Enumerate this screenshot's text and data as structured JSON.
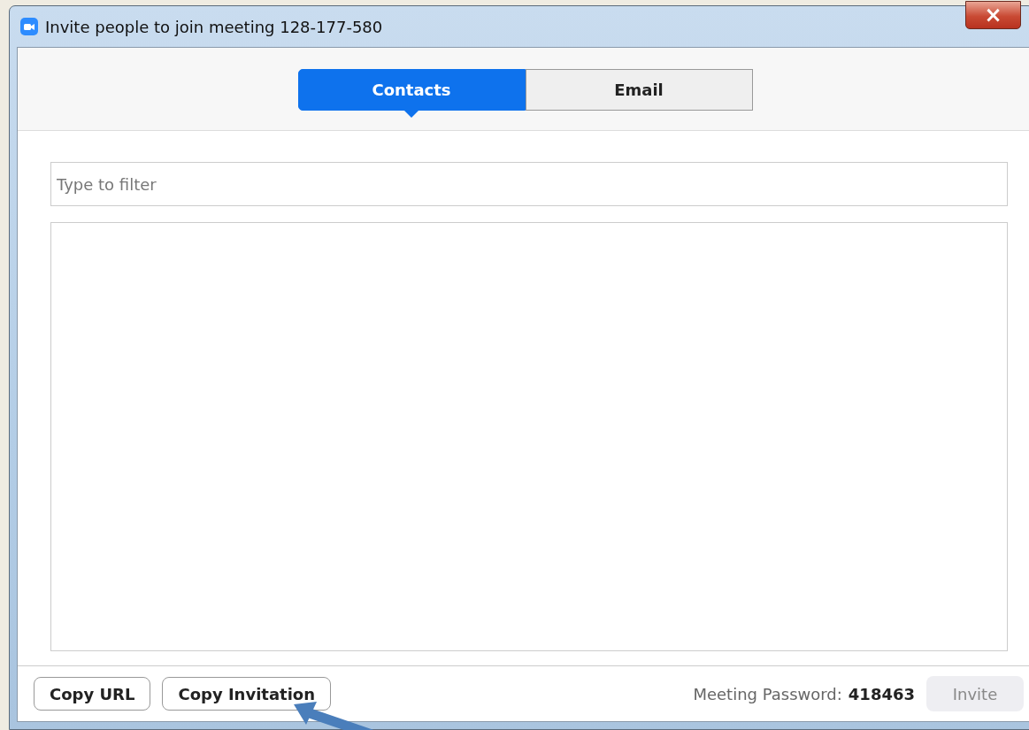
{
  "window": {
    "title": "Invite people to join meeting 128-177-580",
    "close": "×"
  },
  "tabs": [
    {
      "label": "Contacts",
      "selected": true
    },
    {
      "label": "Email",
      "selected": false
    }
  ],
  "filter": {
    "placeholder": "Type to filter"
  },
  "footer": {
    "buttons": [
      {
        "label": "Copy URL"
      },
      {
        "label": "Copy Invitation"
      }
    ],
    "password_label": "Meeting Password:",
    "password": "418463",
    "invite": {
      "label": "Invite",
      "disabled": true
    }
  }
}
